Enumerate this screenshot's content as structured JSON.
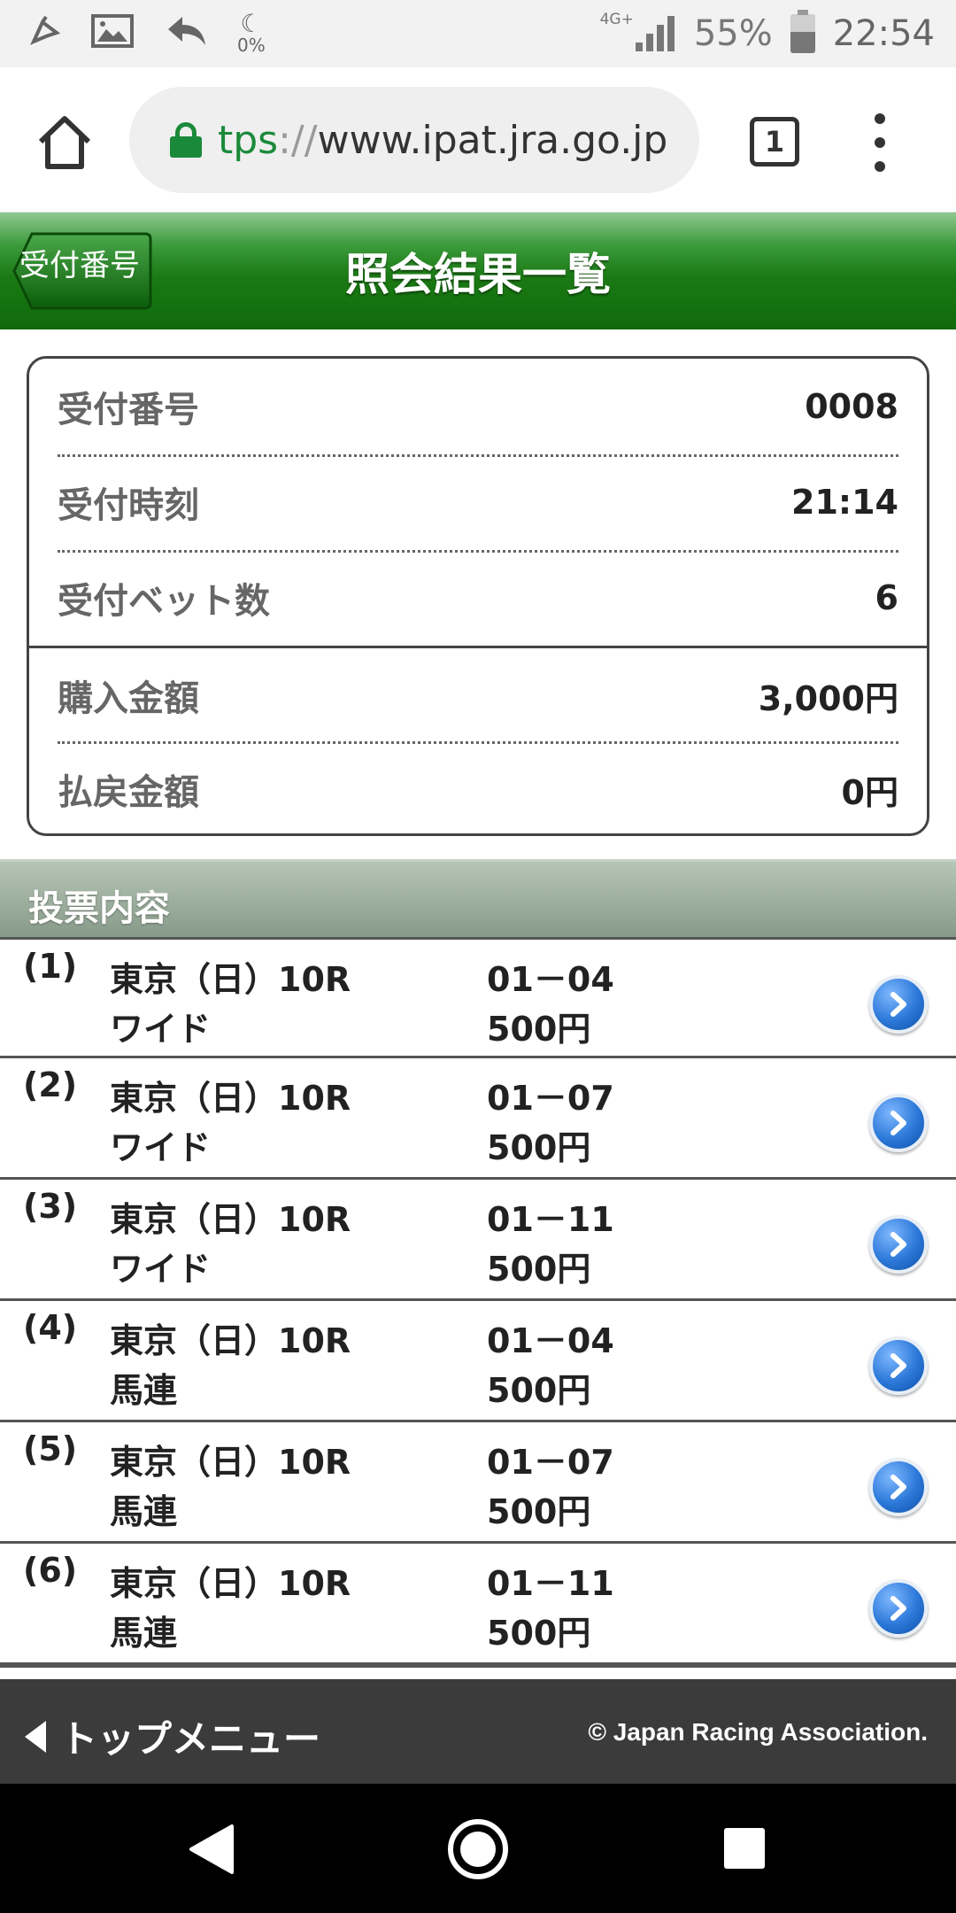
{
  "status_bar": {
    "battery_saver_percent": "0%",
    "network": "4G+",
    "battery_percent": "55%",
    "time": "22:54"
  },
  "browser": {
    "url_scheme": "tps",
    "url_sep": "://",
    "url_host": "www.ipat.jra.go.jp",
    "tab_count": "1"
  },
  "header": {
    "back_label": "受付番号",
    "title": "照会結果一覧"
  },
  "summary": {
    "rows": [
      {
        "label": "受付番号",
        "value": "0008"
      },
      {
        "label": "受付時刻",
        "value": "21:14"
      },
      {
        "label": "受付ベット数",
        "value": "6"
      },
      {
        "label": "購入金額",
        "value": "3,000円"
      },
      {
        "label": "払戻金額",
        "value": "0円"
      }
    ]
  },
  "section": {
    "title": "投票内容"
  },
  "bets": [
    {
      "no": "(1)",
      "race": "東京（日）10R",
      "type": "ワイド",
      "combo": "01－04",
      "amount": "500円"
    },
    {
      "no": "(2)",
      "race": "東京（日）10R",
      "type": "ワイド",
      "combo": "01－07",
      "amount": "500円"
    },
    {
      "no": "(3)",
      "race": "東京（日）10R",
      "type": "ワイド",
      "combo": "01－11",
      "amount": "500円"
    },
    {
      "no": "(4)",
      "race": "東京（日）10R",
      "type": "馬連",
      "combo": "01－04",
      "amount": "500円"
    },
    {
      "no": "(5)",
      "race": "東京（日）10R",
      "type": "馬連",
      "combo": "01－07",
      "amount": "500円"
    },
    {
      "no": "(6)",
      "race": "東京（日）10R",
      "type": "馬連",
      "combo": "01－11",
      "amount": "500円"
    }
  ],
  "footer": {
    "top_menu_label": "トップメニュー",
    "copyright": "© Japan Racing Association."
  },
  "colors": {
    "header_green": "#1b7a14",
    "lock_green": "#1a8a3a",
    "detail_button_blue": "#2b78d8",
    "footer_bg": "#3b3b3b"
  },
  "icons": {
    "status_left": [
      "notification-icon",
      "gallery-icon",
      "reply-icon",
      "battery-saver-icon"
    ],
    "browser": [
      "home-icon",
      "lock-icon",
      "tabs-icon",
      "overflow-menu-icon"
    ],
    "bet_row": "chevron-right-circle-icon",
    "nav": [
      "back-triangle-icon",
      "home-circle-icon",
      "recent-apps-square-icon"
    ]
  }
}
